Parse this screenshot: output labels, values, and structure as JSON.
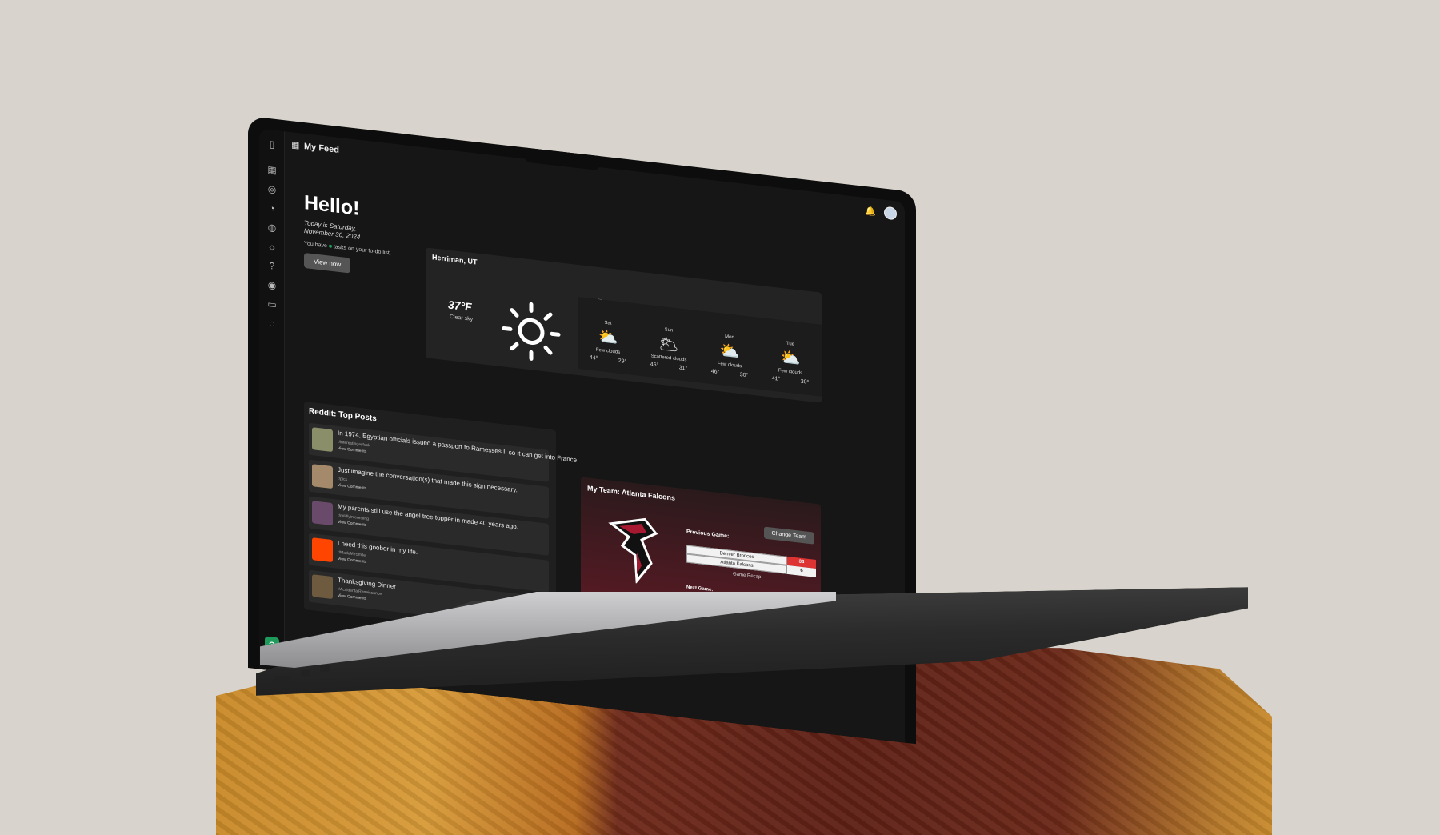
{
  "app": {
    "title": "My Feed"
  },
  "greeting": {
    "title": "Hello!",
    "date_text": "Today is Saturday, November 30, 2024",
    "todo_prefix": "You have",
    "todo_suffix": "tasks on your to-do list.",
    "view_button": "View now"
  },
  "weather": {
    "location": "Herriman, UT",
    "temp": "37°F",
    "condition": "Clear sky",
    "forecast_title": "Forecast",
    "days": [
      {
        "day": "Sat",
        "icon": "partly-cloudy-icon",
        "condition": "Few clouds",
        "high": "44°",
        "low": "29°"
      },
      {
        "day": "Sun",
        "icon": "scattered-clouds-icon",
        "condition": "Scattered clouds",
        "high": "46°",
        "low": "31°"
      },
      {
        "day": "Mon",
        "icon": "partly-cloudy-icon",
        "condition": "Few clouds",
        "high": "46°",
        "low": "30°"
      },
      {
        "day": "Tue",
        "icon": "partly-cloudy-icon",
        "condition": "Few clouds",
        "high": "41°",
        "low": "30°"
      }
    ]
  },
  "reddit": {
    "title": "Reddit: Top Posts",
    "view_comments": "View Comments",
    "posts": [
      {
        "title": "In 1974, Egyptian officials issued a passport to Ramesses II so it can get into France",
        "sub": "r/interestingasfuck",
        "thumb_color": "#8a8f6a"
      },
      {
        "title": "Just imagine the conversation(s) that made this sign necessary.",
        "sub": "r/pics",
        "thumb_color": "#a48a6a"
      },
      {
        "title": "My parents still use the angel tree topper in made 40 years ago.",
        "sub": "r/mildlyinteresting",
        "thumb_color": "#6a4a6a"
      },
      {
        "title": "I need this goober in my life.",
        "sub": "r/MadeMeSmile",
        "thumb_color": "#ff4500"
      },
      {
        "title": "Thanksgiving Dinner",
        "sub": "r/AccidentalRenaissance",
        "thumb_color": "#6e5a3e"
      }
    ]
  },
  "team": {
    "title": "My Team: Atlanta Falcons",
    "change_button": "Change Team",
    "previous_label": "Previous Game:",
    "games": [
      {
        "team": "Denver Broncos",
        "score": "38",
        "color": "#d33"
      },
      {
        "team": "Atlanta Falcons",
        "score": "6",
        "color": "#f2f2f2"
      }
    ],
    "recap_link": "Game Recap",
    "next_label": "Next Game:"
  },
  "colors": {
    "accent": "#1e9a5a",
    "falcons_red": "#a71930"
  }
}
